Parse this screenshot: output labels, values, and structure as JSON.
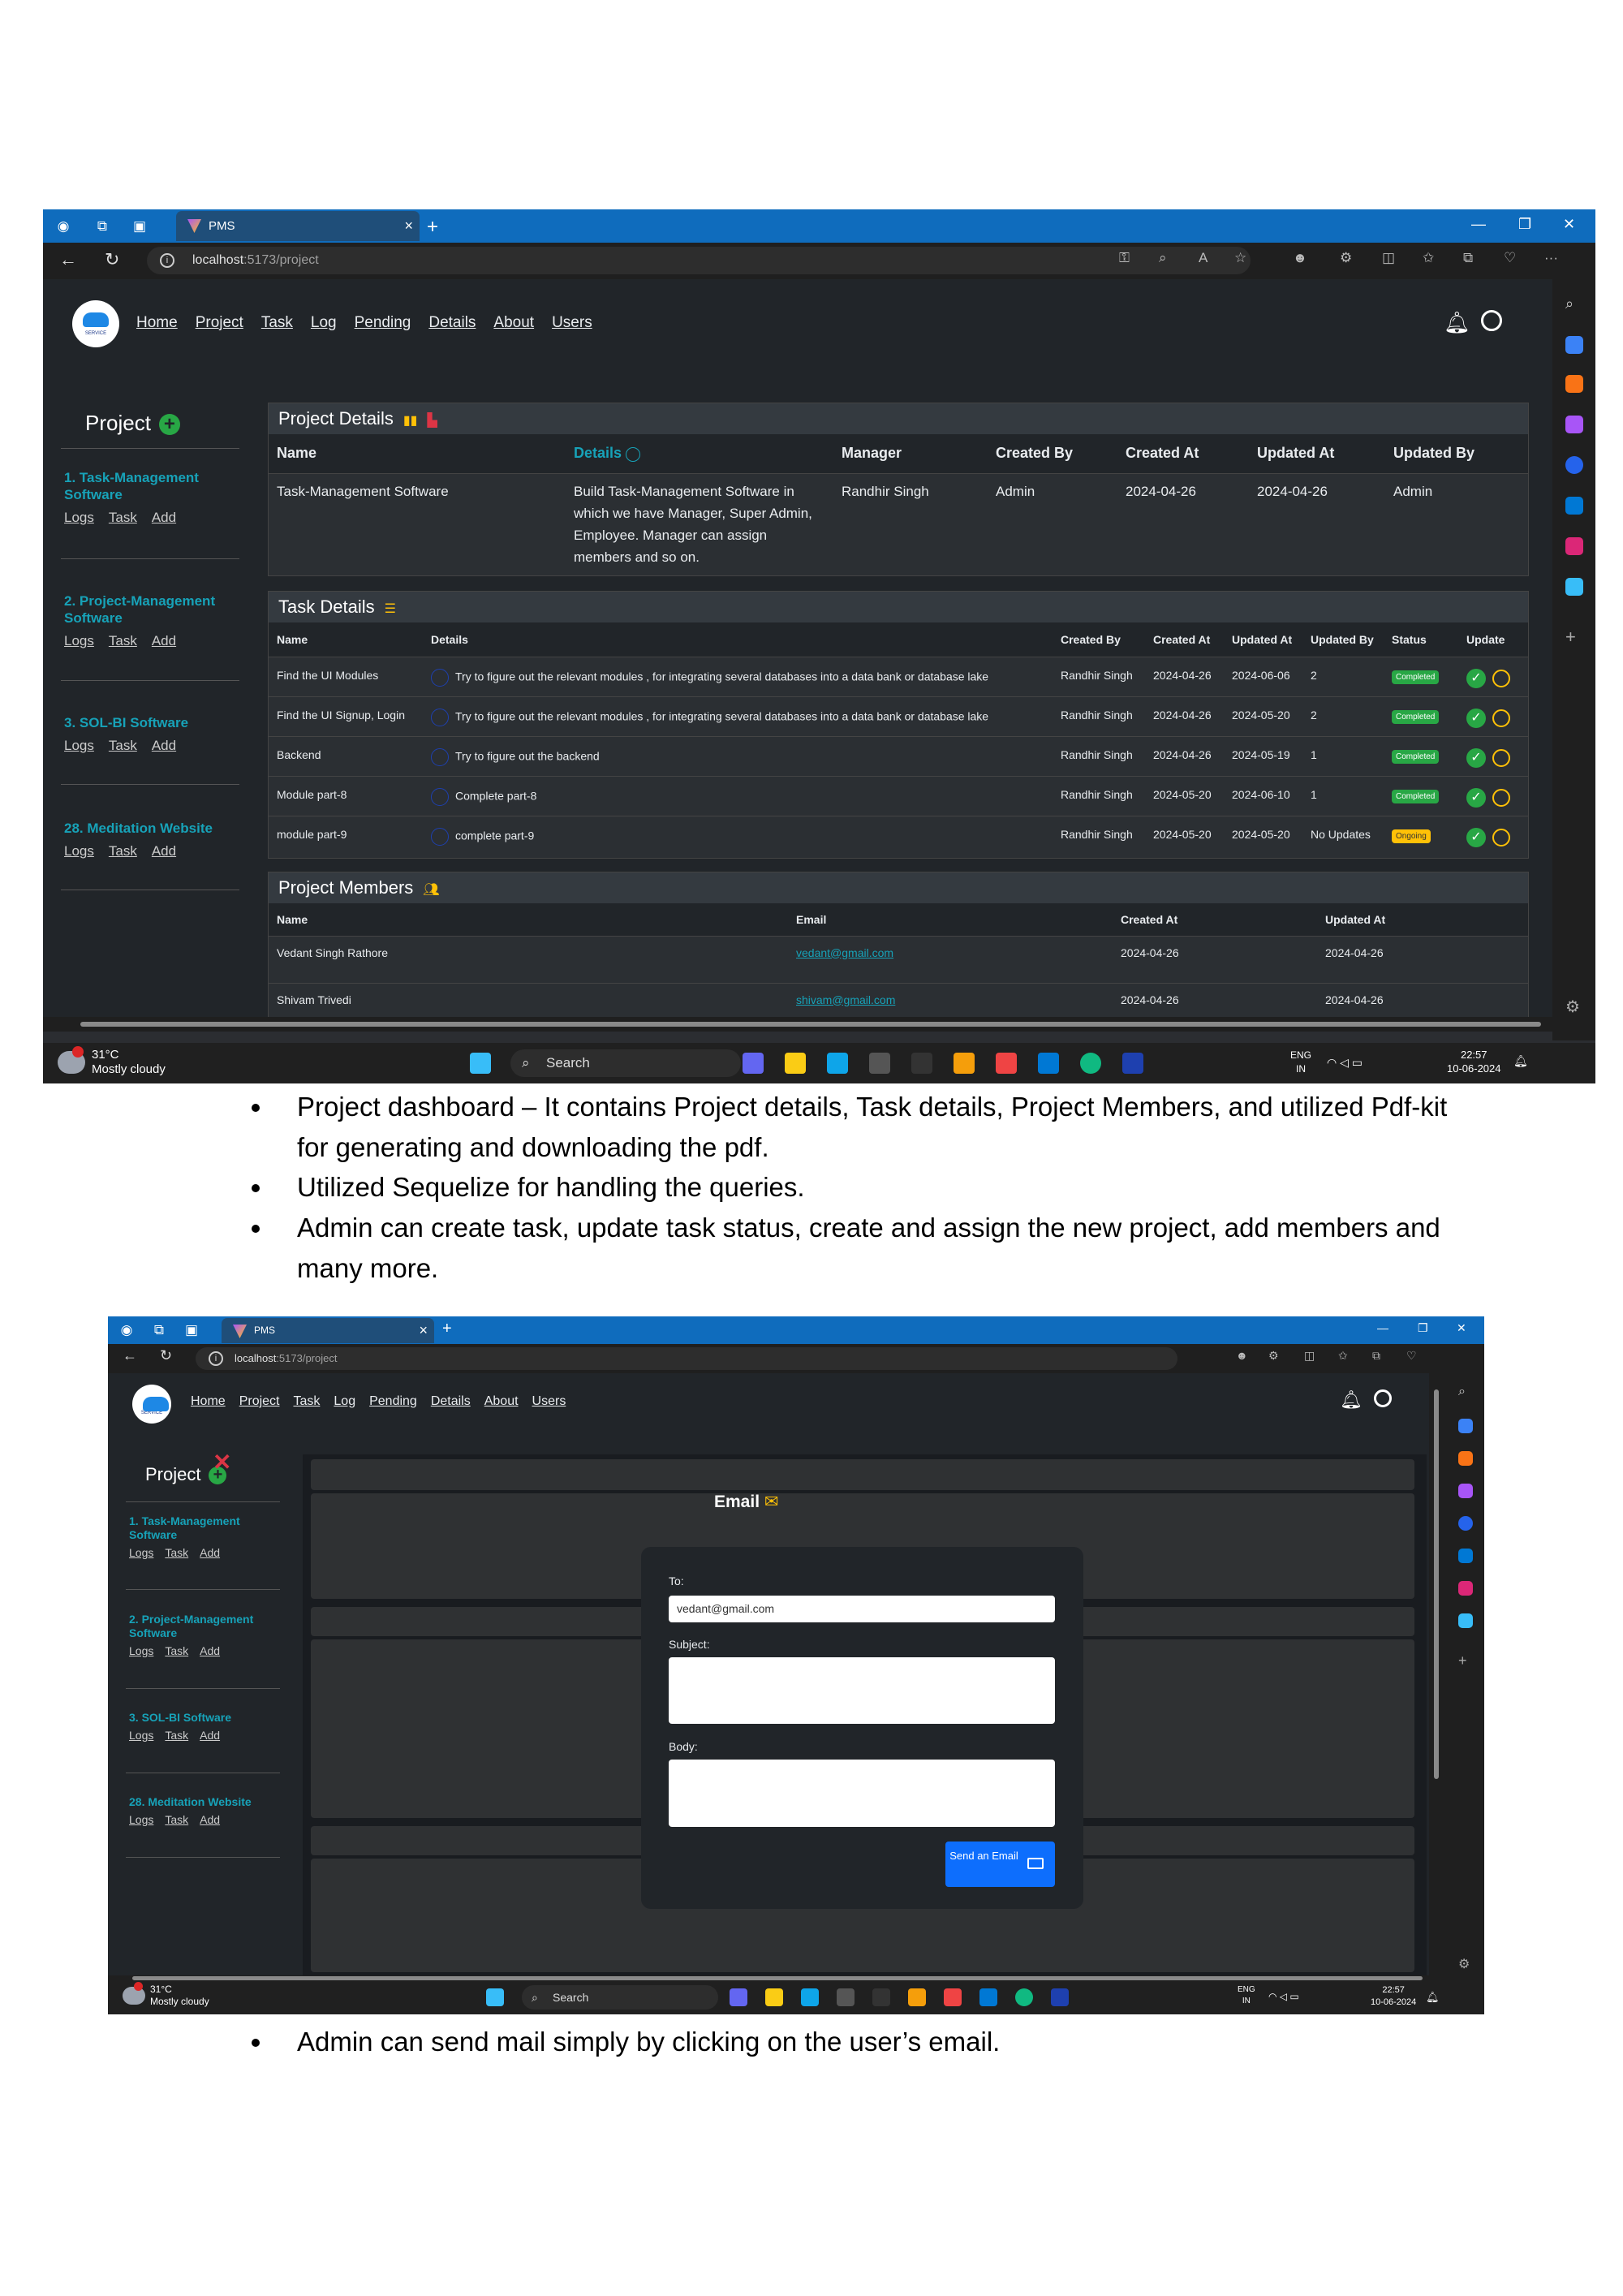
{
  "browser": {
    "tab_title": "PMS",
    "url_host": "localhost",
    "url_path": ":5173/project"
  },
  "nav": {
    "links": [
      "Home",
      "Project",
      "Task",
      "Log",
      "Pending",
      "Details",
      "About",
      "Users"
    ],
    "brand_text": "SERVICE"
  },
  "sidebar": {
    "title": "Project",
    "projects": [
      {
        "name": "1. Task-Management Software",
        "links": [
          "Logs",
          "Task",
          "Add"
        ]
      },
      {
        "name": "2. Project-Management Software",
        "links": [
          "Logs",
          "Task",
          "Add"
        ]
      },
      {
        "name": "3. SOL-BI Software",
        "links": [
          "Logs",
          "Task",
          "Add"
        ]
      },
      {
        "name": "28. Meditation Website",
        "links": [
          "Logs",
          "Task",
          "Add"
        ]
      }
    ]
  },
  "project_details": {
    "title": "Project Details",
    "headers": [
      "Name",
      "Details",
      "Manager",
      "Created By",
      "Created At",
      "Updated At",
      "Updated By"
    ],
    "row": {
      "name": "Task-Management Software",
      "details": "Build Task-Management Software in which we have Manager, Super Admin, Employee. Manager can assign members and so on.",
      "manager": "Randhir Singh",
      "created_by": "Admin",
      "created_at": "2024-04-26",
      "updated_at": "2024-04-26",
      "updated_by": "Admin"
    }
  },
  "task_details": {
    "title": "Task Details",
    "headers": [
      "Name",
      "Details",
      "Created By",
      "Created At",
      "Updated At",
      "Updated By",
      "Status",
      "Update"
    ],
    "rows": [
      {
        "name": "Find the UI Modules",
        "details": "Try to figure out the relevant modules , for integrating several databases into a data bank or database lake",
        "created_by": "Randhir Singh",
        "created_at": "2024-04-26",
        "updated_at": "2024-06-06",
        "updated_by": "2",
        "status": "Completed"
      },
      {
        "name": "Find the UI Signup, Login",
        "details": "Try to figure out the relevant modules , for integrating several databases into a data bank or database lake",
        "created_by": "Randhir Singh",
        "created_at": "2024-04-26",
        "updated_at": "2024-05-20",
        "updated_by": "2",
        "status": "Completed"
      },
      {
        "name": "Backend",
        "details": "Try to figure out the backend",
        "created_by": "Randhir Singh",
        "created_at": "2024-04-26",
        "updated_at": "2024-05-19",
        "updated_by": "1",
        "status": "Completed"
      },
      {
        "name": "Module part-8",
        "details": "Complete part-8",
        "created_by": "Randhir Singh",
        "created_at": "2024-05-20",
        "updated_at": "2024-06-10",
        "updated_by": "1",
        "status": "Completed"
      },
      {
        "name": "module part-9",
        "details": "complete part-9",
        "created_by": "Randhir Singh",
        "created_at": "2024-05-20",
        "updated_at": "2024-05-20",
        "updated_by": "No Updates",
        "status": "Ongoing"
      }
    ]
  },
  "project_members": {
    "title": "Project Members",
    "headers": [
      "Name",
      "Email",
      "Created At",
      "Updated At"
    ],
    "rows": [
      {
        "name": "Vedant Singh Rathore",
        "email": "vedant@gmail.com",
        "created_at": "2024-04-26",
        "updated_at": "2024-04-26"
      },
      {
        "name": "Shivam Trivedi",
        "email": "shivam@gmail.com",
        "created_at": "2024-04-26",
        "updated_at": "2024-04-26"
      }
    ]
  },
  "taskbar": {
    "temp": "31°C",
    "weather": "Mostly cloudy",
    "search": "Search",
    "lang1": "ENG",
    "lang2": "IN",
    "time": "22:57",
    "date": "10-06-2024"
  },
  "bullets_1": [
    "Project dashboard – It contains Project details, Task details, Project Members, and utilized Pdf-kit for generating and downloading the pdf.",
    "Utilized Sequelize for handling the queries.",
    "Admin can create task, update task status, create and assign the new project, add members and many more."
  ],
  "email_modal": {
    "title": "Email",
    "to_label": "To:",
    "to_value": "vedant@gmail.com",
    "subject_label": "Subject:",
    "body_label": "Body:",
    "send_label": "Send an Email"
  },
  "bullets_2": [
    "Admin can send mail simply by clicking on the user’s email."
  ]
}
